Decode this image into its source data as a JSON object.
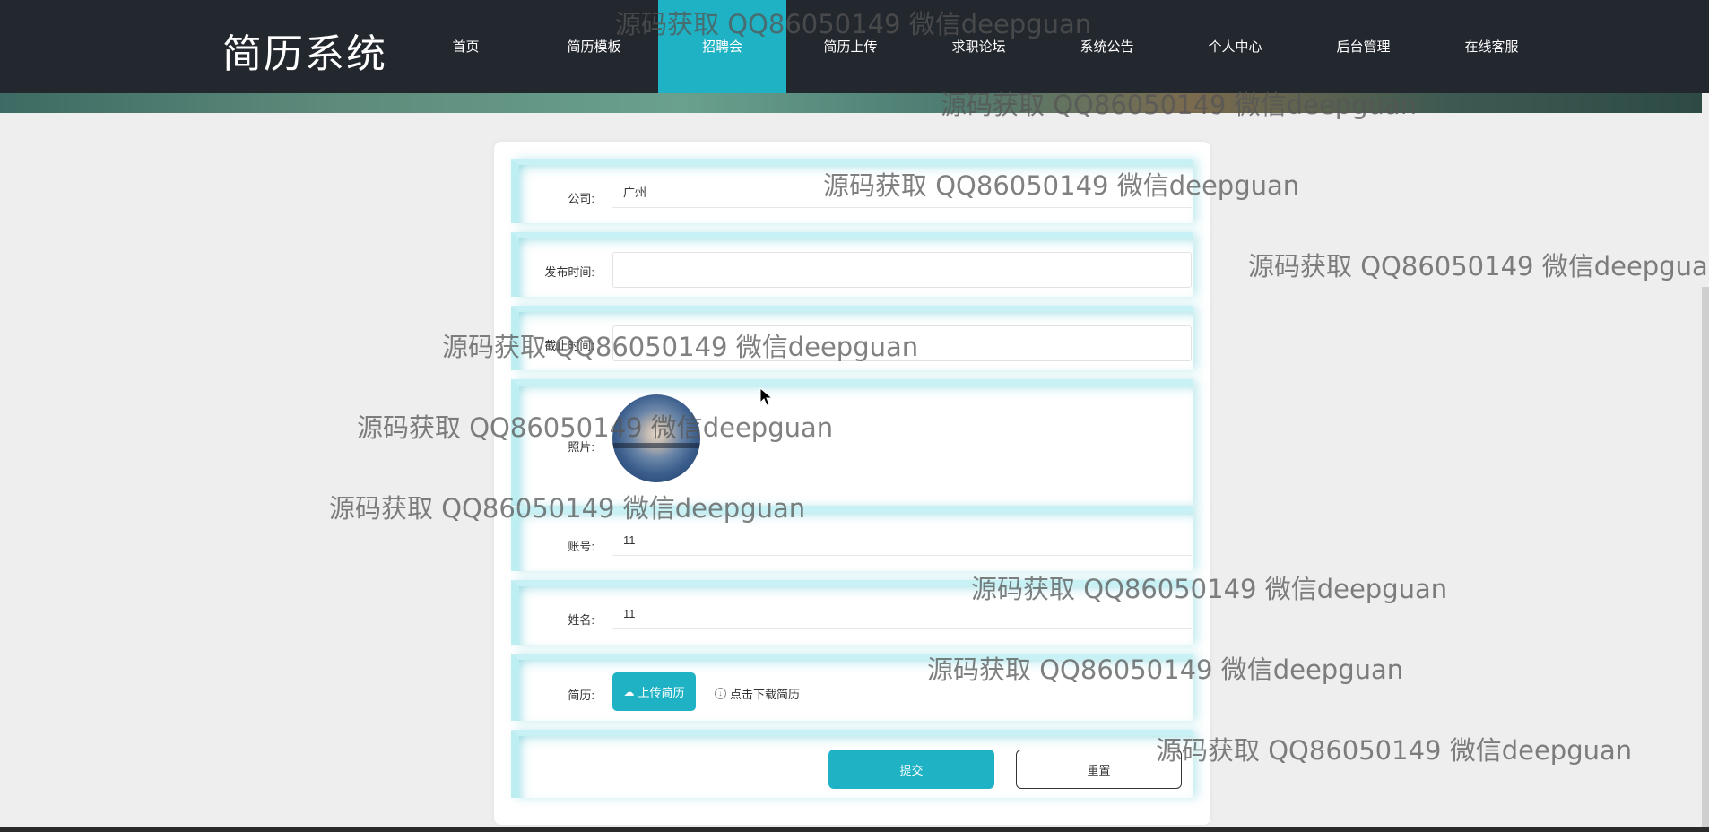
{
  "header": {
    "logo": "简历系统",
    "nav": [
      {
        "label": "首页"
      },
      {
        "label": "简历模板"
      },
      {
        "label": "招聘会",
        "active": true
      },
      {
        "label": "简历上传"
      },
      {
        "label": "求职论坛"
      },
      {
        "label": "系统公告"
      },
      {
        "label": "个人中心"
      },
      {
        "label": "后台管理"
      },
      {
        "label": "在线客服"
      }
    ],
    "active_color": "#1eb2c4",
    "bg_color": "#23272e"
  },
  "form": {
    "company": {
      "label": "公司:",
      "value": "广州"
    },
    "publish_time": {
      "label": "发布时间:",
      "value": ""
    },
    "deadline": {
      "label": "截止时间:",
      "value": ""
    },
    "photo": {
      "label": "照片:"
    },
    "account": {
      "label": "账号:",
      "value": "11"
    },
    "name": {
      "label": "姓名:",
      "value": "11"
    },
    "resume": {
      "label": "简历:",
      "upload_label": "上传简历",
      "download_label": "点击下载简历"
    },
    "submit_label": "提交",
    "reset_label": "重置"
  },
  "watermark": {
    "text": "源码获取 QQ86050149 微信deepguan"
  },
  "icons": {
    "upload": "cloud-upload-icon",
    "download": "download-circle-icon",
    "cursor": "mouse-pointer-icon"
  }
}
